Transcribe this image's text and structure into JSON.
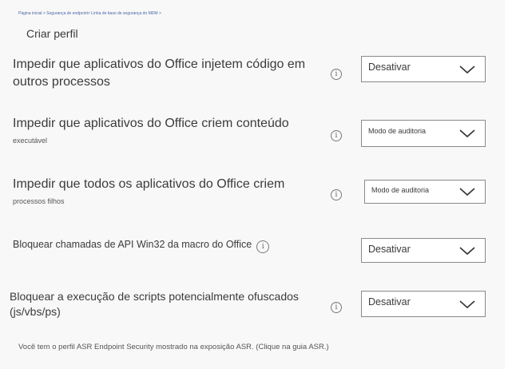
{
  "breadcrumb": "Página inicial > Segurança de endpoint> Linha de base de segurança do MDM >",
  "page_title": "Criar perfil",
  "settings": [
    {
      "label": "Impedir que aplicativos do Office injetem código em outros processos",
      "subtext": "",
      "value": "Desativar",
      "info_icon": "info-icon"
    },
    {
      "label": "Impedir que aplicativos do Office criem conteúdo",
      "subtext": "executável",
      "value": "Modo de auditoria",
      "info_icon": "info-icon"
    },
    {
      "label": "Impedir que todos os aplicativos do Office criem",
      "subtext": "processos filhos",
      "value": "Modo de auditoria",
      "info_icon": "info-icon"
    },
    {
      "label": "Bloquear chamadas de API Win32 da macro do Office",
      "subtext": "",
      "value": "Desativar",
      "info_icon": "info-icon"
    },
    {
      "label": "Bloquear a execução de scripts potencialmente ofuscados (js/vbs/ps)",
      "subtext": "",
      "value": "Desativar",
      "info_icon": "info-icon"
    }
  ],
  "footer": "Você tem o perfil ASR Endpoint Security mostrado na exposição ASR. (Clique na guia ASR.)",
  "colors": {
    "panel_background": "#f8f8f8",
    "breadcrumb_link": "#4a66a8",
    "dropdown_border": "#8a8a8a"
  }
}
